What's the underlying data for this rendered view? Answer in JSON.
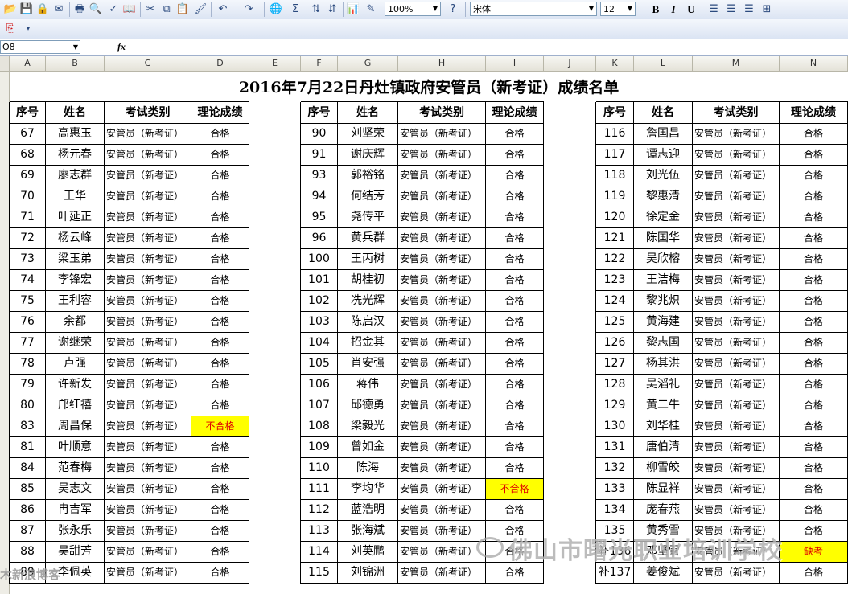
{
  "toolbar": {
    "zoom": "100%",
    "font_name": "宋体",
    "font_size": "12",
    "bold": "B",
    "italic": "I",
    "underline": "U",
    "sum": "Σ"
  },
  "formula_bar": {
    "cell_ref": "O8",
    "fx": "fx",
    "content": ""
  },
  "columns": [
    "A",
    "B",
    "C",
    "D",
    "E",
    "F",
    "G",
    "H",
    "I",
    "J",
    "K",
    "L",
    "M",
    "N"
  ],
  "sheet": {
    "title": "2016年7月22日丹灶镇政府安管员（新考证）成绩名单",
    "headers": [
      "序号",
      "姓名",
      "考试类别",
      "理论成绩"
    ],
    "groups": [
      {
        "rows": [
          {
            "no": "67",
            "name": "高惠玉",
            "cat": "安管员（新考证）",
            "res": "合格",
            "flag": false
          },
          {
            "no": "68",
            "name": "杨元春",
            "cat": "安管员（新考证）",
            "res": "合格",
            "flag": false
          },
          {
            "no": "69",
            "name": "廖志群",
            "cat": "安管员（新考证）",
            "res": "合格",
            "flag": false
          },
          {
            "no": "70",
            "name": "王华",
            "cat": "安管员（新考证）",
            "res": "合格",
            "flag": false
          },
          {
            "no": "71",
            "name": "叶延正",
            "cat": "安管员（新考证）",
            "res": "合格",
            "flag": false
          },
          {
            "no": "72",
            "name": "杨云峰",
            "cat": "安管员（新考证）",
            "res": "合格",
            "flag": false
          },
          {
            "no": "73",
            "name": "梁玉弟",
            "cat": "安管员（新考证）",
            "res": "合格",
            "flag": false
          },
          {
            "no": "74",
            "name": "李锋宏",
            "cat": "安管员（新考证）",
            "res": "合格",
            "flag": false
          },
          {
            "no": "75",
            "name": "王利容",
            "cat": "安管员（新考证）",
            "res": "合格",
            "flag": false
          },
          {
            "no": "76",
            "name": "余都",
            "cat": "安管员（新考证）",
            "res": "合格",
            "flag": false
          },
          {
            "no": "77",
            "name": "谢继荣",
            "cat": "安管员（新考证）",
            "res": "合格",
            "flag": false
          },
          {
            "no": "78",
            "name": "卢强",
            "cat": "安管员（新考证）",
            "res": "合格",
            "flag": false
          },
          {
            "no": "79",
            "name": "许新发",
            "cat": "安管员（新考证）",
            "res": "合格",
            "flag": false
          },
          {
            "no": "80",
            "name": "邝红禧",
            "cat": "安管员（新考证）",
            "res": "合格",
            "flag": false
          },
          {
            "no": "83",
            "name": "周昌保",
            "cat": "安管员（新考证）",
            "res": "不合格",
            "flag": true
          },
          {
            "no": "81",
            "name": "叶顺意",
            "cat": "安管员（新考证）",
            "res": "合格",
            "flag": false
          },
          {
            "no": "84",
            "name": "范春梅",
            "cat": "安管员（新考证）",
            "res": "合格",
            "flag": false
          },
          {
            "no": "85",
            "name": "吴志文",
            "cat": "安管员（新考证）",
            "res": "合格",
            "flag": false
          },
          {
            "no": "86",
            "name": "冉吉军",
            "cat": "安管员（新考证）",
            "res": "合格",
            "flag": false
          },
          {
            "no": "87",
            "name": "张永乐",
            "cat": "安管员（新考证）",
            "res": "合格",
            "flag": false
          },
          {
            "no": "88",
            "name": "吴甜芳",
            "cat": "安管员（新考证）",
            "res": "合格",
            "flag": false
          },
          {
            "no": "89",
            "name": "李佩英",
            "cat": "安管员（新考证）",
            "res": "合格",
            "flag": false
          }
        ]
      },
      {
        "rows": [
          {
            "no": "90",
            "name": "刘坚荣",
            "cat": "安管员（新考证）",
            "res": "合格",
            "flag": false
          },
          {
            "no": "91",
            "name": "谢庆辉",
            "cat": "安管员（新考证）",
            "res": "合格",
            "flag": false
          },
          {
            "no": "93",
            "name": "郭裕铭",
            "cat": "安管员（新考证）",
            "res": "合格",
            "flag": false
          },
          {
            "no": "94",
            "name": "何结芳",
            "cat": "安管员（新考证）",
            "res": "合格",
            "flag": false
          },
          {
            "no": "95",
            "name": "尧传平",
            "cat": "安管员（新考证）",
            "res": "合格",
            "flag": false
          },
          {
            "no": "96",
            "name": "黄兵群",
            "cat": "安管员（新考证）",
            "res": "合格",
            "flag": false
          },
          {
            "no": "100",
            "name": "王丙树",
            "cat": "安管员（新考证）",
            "res": "合格",
            "flag": false
          },
          {
            "no": "101",
            "name": "胡桂初",
            "cat": "安管员（新考证）",
            "res": "合格",
            "flag": false
          },
          {
            "no": "102",
            "name": "冼光辉",
            "cat": "安管员（新考证）",
            "res": "合格",
            "flag": false
          },
          {
            "no": "103",
            "name": "陈启汉",
            "cat": "安管员（新考证）",
            "res": "合格",
            "flag": false
          },
          {
            "no": "104",
            "name": "招金其",
            "cat": "安管员（新考证）",
            "res": "合格",
            "flag": false
          },
          {
            "no": "105",
            "name": "肖安强",
            "cat": "安管员（新考证）",
            "res": "合格",
            "flag": false
          },
          {
            "no": "106",
            "name": "蒋伟",
            "cat": "安管员（新考证）",
            "res": "合格",
            "flag": false
          },
          {
            "no": "107",
            "name": "邱德勇",
            "cat": "安管员（新考证）",
            "res": "合格",
            "flag": false
          },
          {
            "no": "108",
            "name": "梁毅光",
            "cat": "安管员（新考证）",
            "res": "合格",
            "flag": false
          },
          {
            "no": "109",
            "name": "曾如金",
            "cat": "安管员（新考证）",
            "res": "合格",
            "flag": false
          },
          {
            "no": "110",
            "name": "陈海",
            "cat": "安管员（新考证）",
            "res": "合格",
            "flag": false
          },
          {
            "no": "111",
            "name": "李均华",
            "cat": "安管员（新考证）",
            "res": "不合格",
            "flag": true
          },
          {
            "no": "112",
            "name": "蓝浩明",
            "cat": "安管员（新考证）",
            "res": "合格",
            "flag": false
          },
          {
            "no": "113",
            "name": "张海斌",
            "cat": "安管员（新考证）",
            "res": "合格",
            "flag": false
          },
          {
            "no": "114",
            "name": "刘英鹏",
            "cat": "安管员（新考证）",
            "res": "合格",
            "flag": false
          },
          {
            "no": "115",
            "name": "刘锦洲",
            "cat": "安管员（新考证）",
            "res": "合格",
            "flag": false
          }
        ]
      },
      {
        "rows": [
          {
            "no": "116",
            "name": "詹国昌",
            "cat": "安管员（新考证）",
            "res": "合格",
            "flag": false
          },
          {
            "no": "117",
            "name": "谭志迎",
            "cat": "安管员（新考证）",
            "res": "合格",
            "flag": false
          },
          {
            "no": "118",
            "name": "刘光伍",
            "cat": "安管员（新考证）",
            "res": "合格",
            "flag": false
          },
          {
            "no": "119",
            "name": "黎惠清",
            "cat": "安管员（新考证）",
            "res": "合格",
            "flag": false
          },
          {
            "no": "120",
            "name": "徐定金",
            "cat": "安管员（新考证）",
            "res": "合格",
            "flag": false
          },
          {
            "no": "121",
            "name": "陈国华",
            "cat": "安管员（新考证）",
            "res": "合格",
            "flag": false
          },
          {
            "no": "122",
            "name": "吴欣榕",
            "cat": "安管员（新考证）",
            "res": "合格",
            "flag": false
          },
          {
            "no": "123",
            "name": "王洁梅",
            "cat": "安管员（新考证）",
            "res": "合格",
            "flag": false
          },
          {
            "no": "124",
            "name": "黎兆炽",
            "cat": "安管员（新考证）",
            "res": "合格",
            "flag": false
          },
          {
            "no": "125",
            "name": "黄海建",
            "cat": "安管员（新考证）",
            "res": "合格",
            "flag": false
          },
          {
            "no": "126",
            "name": "黎志国",
            "cat": "安管员（新考证）",
            "res": "合格",
            "flag": false
          },
          {
            "no": "127",
            "name": "杨其洪",
            "cat": "安管员（新考证）",
            "res": "合格",
            "flag": false
          },
          {
            "no": "128",
            "name": "吴滔礼",
            "cat": "安管员（新考证）",
            "res": "合格",
            "flag": false
          },
          {
            "no": "129",
            "name": "黄二牛",
            "cat": "安管员（新考证）",
            "res": "合格",
            "flag": false
          },
          {
            "no": "130",
            "name": "刘华桂",
            "cat": "安管员（新考证）",
            "res": "合格",
            "flag": false
          },
          {
            "no": "131",
            "name": "唐伯清",
            "cat": "安管员（新考证）",
            "res": "合格",
            "flag": false
          },
          {
            "no": "132",
            "name": "柳雪皎",
            "cat": "安管员（新考证）",
            "res": "合格",
            "flag": false
          },
          {
            "no": "133",
            "name": "陈显祥",
            "cat": "安管员（新考证）",
            "res": "合格",
            "flag": false
          },
          {
            "no": "134",
            "name": "庞春燕",
            "cat": "安管员（新考证）",
            "res": "合格",
            "flag": false
          },
          {
            "no": "135",
            "name": "黄秀雪",
            "cat": "安管员（新考证）",
            "res": "合格",
            "flag": false
          },
          {
            "no": "补136",
            "name": "邓坚雪",
            "cat": "安管员（新考证）",
            "res": "缺考",
            "flag": true
          },
          {
            "no": "补137",
            "name": "姜俊斌",
            "cat": "安管员（新考证）",
            "res": "合格",
            "flag": false
          }
        ]
      }
    ]
  },
  "watermark": "佛山市曙光职业培训学校",
  "corner_watermark": "木新浪博客"
}
